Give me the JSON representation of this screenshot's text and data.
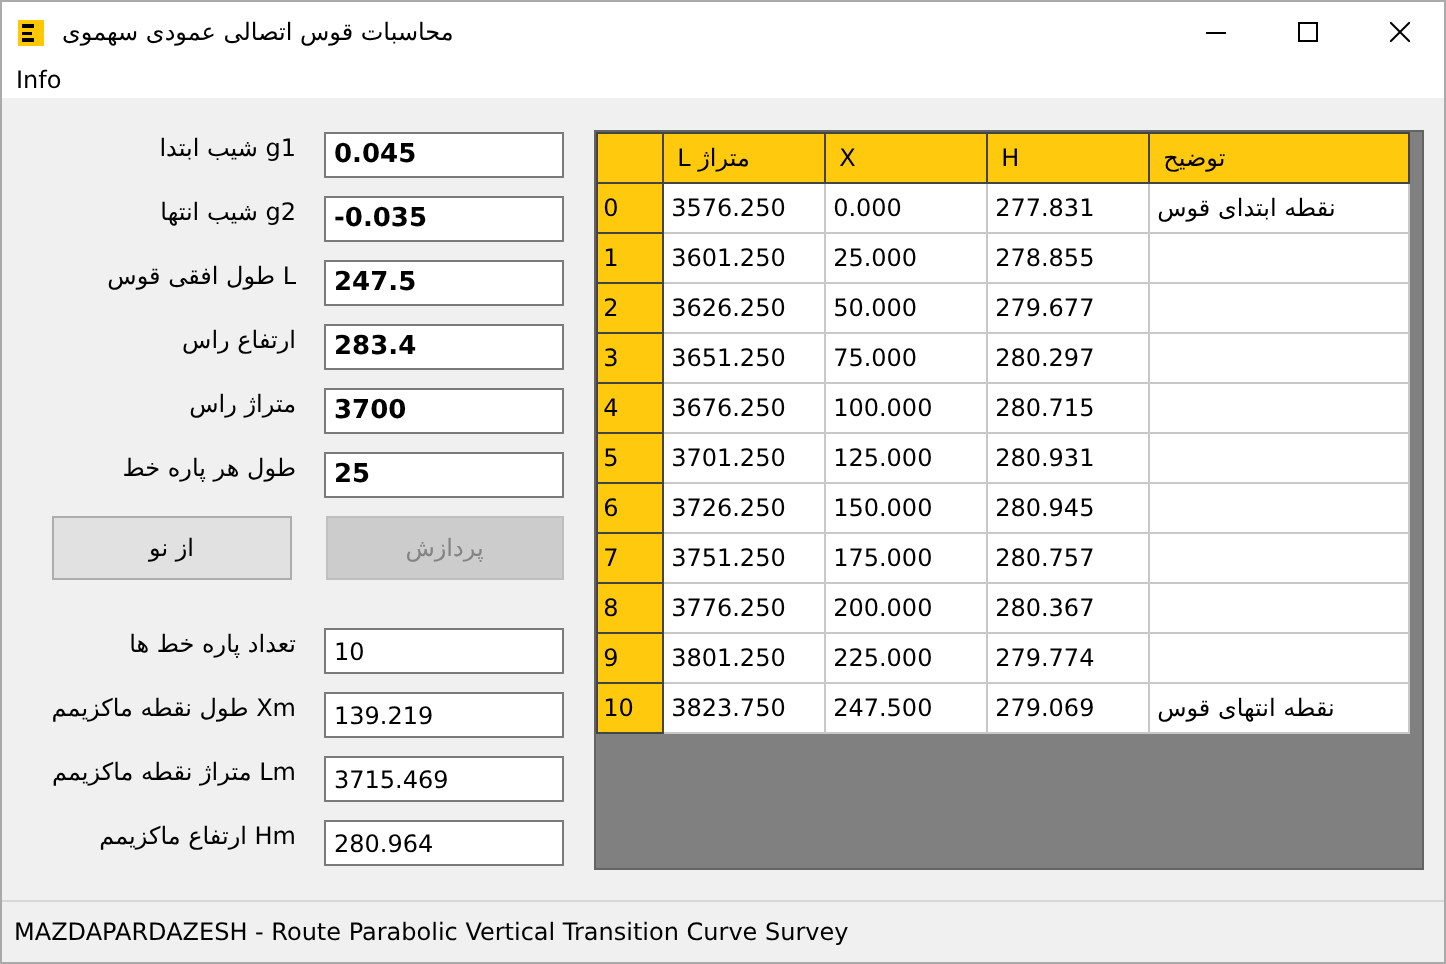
{
  "window": {
    "title": "محاسبات قوس اتصالی عمودی سهموی"
  },
  "menu": [
    "Info"
  ],
  "inputs": [
    {
      "label": "g1 شیب ابتدا",
      "value": "0.045"
    },
    {
      "label": "g2 شیب انتها",
      "value": "-0.035"
    },
    {
      "label": "L طول افقی قوس",
      "value": "247.5"
    },
    {
      "label": "ارتفاع راس",
      "value": "283.4"
    },
    {
      "label": "متراژ راس",
      "value": "3700"
    },
    {
      "label": "طول هر پاره خط",
      "value": "25"
    }
  ],
  "buttons": [
    {
      "label": "پردازش",
      "disabled": true
    },
    {
      "label": "از نو",
      "disabled": false
    }
  ],
  "results": [
    {
      "label": "تعداد پاره خط ها",
      "value": "10"
    },
    {
      "label": "Xm طول نقطه ماکزیمم",
      "value": "139.219"
    },
    {
      "label": "Lm متراژ نقطه ماکزیمم",
      "value": "3715.469"
    },
    {
      "label": "Hm ارتفاع ماکزیمم",
      "value": "280.964"
    }
  ],
  "table": {
    "columns": [
      "متراژ L",
      "X",
      "H",
      "توضیح"
    ],
    "rows": [
      {
        "index": "0",
        "cells": [
          "3576.250",
          "0.000",
          "277.831",
          "نقطه ابتدای قوس"
        ]
      },
      {
        "index": "1",
        "cells": [
          "3601.250",
          "25.000",
          "278.855",
          ""
        ]
      },
      {
        "index": "2",
        "cells": [
          "3626.250",
          "50.000",
          "279.677",
          ""
        ]
      },
      {
        "index": "3",
        "cells": [
          "3651.250",
          "75.000",
          "280.297",
          ""
        ]
      },
      {
        "index": "4",
        "cells": [
          "3676.250",
          "100.000",
          "280.715",
          ""
        ]
      },
      {
        "index": "5",
        "cells": [
          "3701.250",
          "125.000",
          "280.931",
          ""
        ]
      },
      {
        "index": "6",
        "cells": [
          "3726.250",
          "150.000",
          "280.945",
          ""
        ]
      },
      {
        "index": "7",
        "cells": [
          "3751.250",
          "175.000",
          "280.757",
          ""
        ]
      },
      {
        "index": "8",
        "cells": [
          "3776.250",
          "200.000",
          "280.367",
          ""
        ]
      },
      {
        "index": "9",
        "cells": [
          "3801.250",
          "225.000",
          "279.774",
          ""
        ]
      },
      {
        "index": "10",
        "cells": [
          "3823.750",
          "247.500",
          "279.069",
          "نقطه انتهای قوس"
        ]
      }
    ]
  },
  "status_bar": "MAZDAPARDAZESH - Route Parabolic Vertical Transition Curve Survey"
}
